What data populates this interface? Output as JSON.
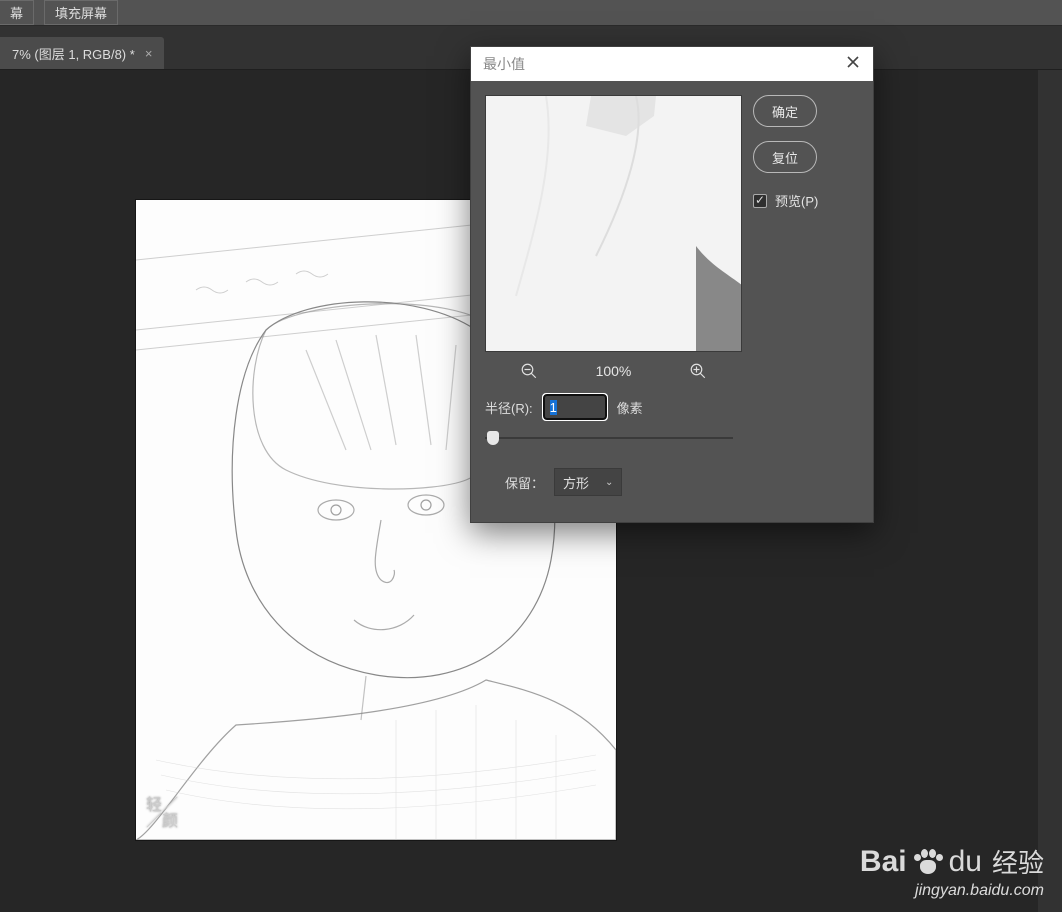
{
  "toolbar": {
    "btn_partial_label": "幕",
    "btn_fillscreen_label": "填充屏幕"
  },
  "tab": {
    "title": "7% (图层 1, RGB/8) *"
  },
  "canvas": {
    "watermark_line1": "轻／",
    "watermark_line2": "／颜"
  },
  "dialog": {
    "title": "最小值",
    "ok_label": "确定",
    "reset_label": "复位",
    "preview_label": "预览(P)",
    "preview_checked": true
  },
  "preview": {
    "zoom_text": "100%"
  },
  "radius": {
    "label": "半径(R):",
    "value": "1",
    "unit": "像素"
  },
  "preserve": {
    "label": "保留：",
    "selected": "方形"
  },
  "watermark": {
    "brand_part1": "Bai",
    "brand_part2": "du",
    "brand_part3": "经验",
    "url": "jingyan.baidu.com"
  }
}
